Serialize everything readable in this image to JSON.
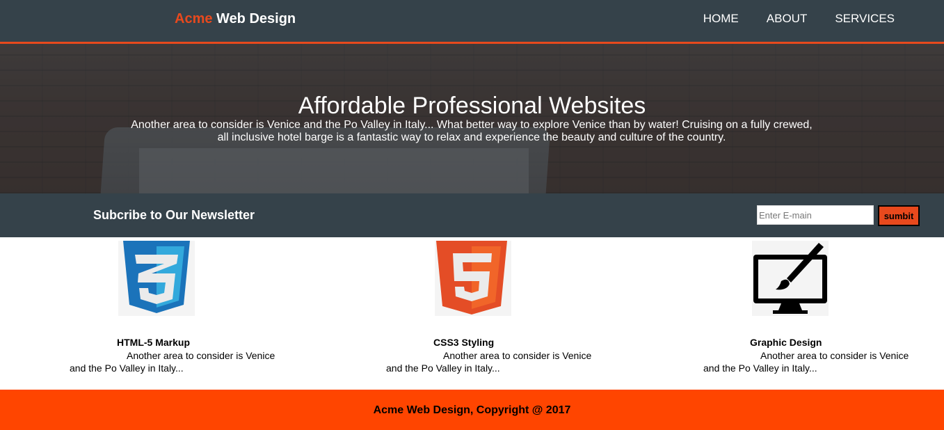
{
  "header": {
    "brand_highlight": "Acme",
    "brand_rest": "Web Design",
    "nav": [
      {
        "label": "HOME"
      },
      {
        "label": "ABOUT"
      },
      {
        "label": "SERVICES"
      }
    ]
  },
  "showcase": {
    "title": "Affordable Professional Websites",
    "text_line1": "Another area to consider is Venice and the Po Valley in Italy... What better way to explore Venice than by water! Cruising on a fully crewed,",
    "text_line2": "all inclusive hotel barge is a fantastic way to relax and experience the beauty and culture of the country."
  },
  "newsletter": {
    "title": "Subcribe to Our Newsletter",
    "email_placeholder": "Enter E-main",
    "button_label": "sumbit"
  },
  "boxes": [
    {
      "icon": "css3-logo-icon",
      "title": "HTML-5 Markup",
      "text": "Another area to consider is Venice and the Po Valley in Italy..."
    },
    {
      "icon": "html5-logo-icon",
      "title": "CSS3 Styling",
      "text": "Another area to consider is Venice and the Po Valley in Italy..."
    },
    {
      "icon": "monitor-brush-icon",
      "title": "Graphic Design",
      "text": "Another area to consider is Venice and the Po Valley in Italy..."
    }
  ],
  "footer": {
    "text": "Acme Web Design, Copyright @ 2017"
  },
  "colors": {
    "dark": "#35424a",
    "accent": "#e8491d",
    "footer": "#ff4500"
  }
}
